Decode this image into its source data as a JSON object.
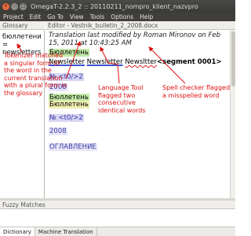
{
  "window": {
    "title": "OmegaT-2.2.3_2 :: 20110211_nompro_klient_nazvpro",
    "close_glyph": "×",
    "min_glyph": "–",
    "max_glyph": "□"
  },
  "menu": {
    "items": [
      "Project",
      "Edit",
      "Go To",
      "View",
      "Tools",
      "Options",
      "Help"
    ]
  },
  "glossary": {
    "header": "Glossary",
    "entry": "бюллетени = newsletters"
  },
  "editor": {
    "header": "Editor - Vestnik_bulletin_2_2008.docx",
    "translation_info": "Translation last modified by Roman Mironov on Feb 15, 2011 at 10:43:25 AM",
    "source": "Бюллетень",
    "target_words": [
      "Newsletter",
      "Newsletter",
      "Newsltter"
    ],
    "segment_marker": "<segment 0001>",
    "lines": [
      "№ <t0/>2",
      "2008",
      "Бюллетень",
      "Бюллетень",
      "№ <t0/>2",
      "2008",
      "ОГЛАВЛЕНИЕ"
    ]
  },
  "fuzzy": {
    "header": "Fuzzy Matches"
  },
  "tabs": {
    "items": [
      "Dictionary",
      "Machine Translation"
    ]
  },
  "annotations": {
    "tokenizer": "Tokenizer matched a singular form of the word in the current translation with a plural form in the glossary",
    "language_tool": "Language Tool flagged two consecutive identical words",
    "spell_checker": "Spell checker flagged a misspelled word"
  },
  "colors": {
    "annotation": "#dd1111",
    "source_highlight": "#bfe8a6",
    "tag_highlight": "#d7d5f2",
    "grammar_underline": "#3a55d6",
    "spell_underline": "#dd2222"
  }
}
